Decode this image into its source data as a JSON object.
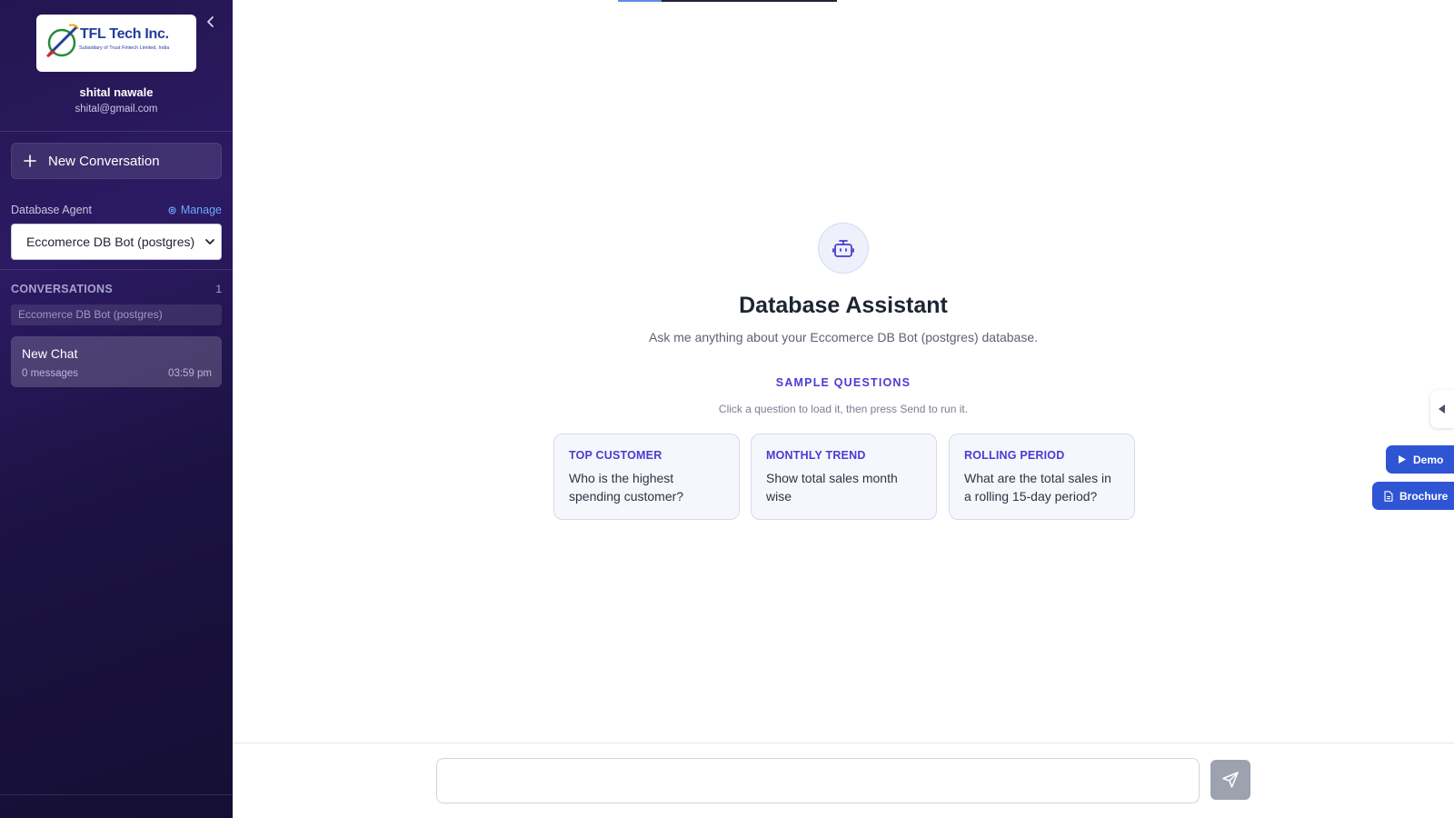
{
  "sidebar": {
    "logo": {
      "name": "TFL Tech Inc.",
      "tagline": "Subsidiary of Trust Fintech Limited, India"
    },
    "user": {
      "name": "shital nawale",
      "email": "shital@gmail.com"
    },
    "new_conversation_label": "New Conversation",
    "database_agent": {
      "label": "Database Agent",
      "manage_label": "Manage",
      "selected": "Eccomerce DB Bot (postgres)"
    },
    "conversations": {
      "title": "CONVERSATIONS",
      "count": "1",
      "filter_text": "Eccomerce DB Bot (postgres)",
      "items": [
        {
          "title": "New Chat",
          "messages": "0 messages",
          "time": "03:59 pm"
        }
      ]
    }
  },
  "main": {
    "title": "Database Assistant",
    "subtitle": "Ask me anything about your Eccomerce DB Bot (postgres) database.",
    "sample_heading": "SAMPLE QUESTIONS",
    "sample_hint": "Click a question to load it, then press Send to run it.",
    "samples": [
      {
        "key": "TOP CUSTOMER",
        "question": "Who is the highest spending customer?"
      },
      {
        "key": "MONTHLY TREND",
        "question": "Show total sales month wise"
      },
      {
        "key": "ROLLING PERIOD",
        "question": "What are the total sales in a rolling 15-day period?"
      }
    ]
  },
  "chat": {
    "input_value": "",
    "placeholder": ""
  },
  "floating": {
    "demo_label": "Demo",
    "brochure_label": "Brochure"
  },
  "colors": {
    "sidebar_bg": "#231650",
    "accent": "#4b3bd1",
    "float_button": "#2f55d4",
    "send_button": "#9ca3af"
  }
}
